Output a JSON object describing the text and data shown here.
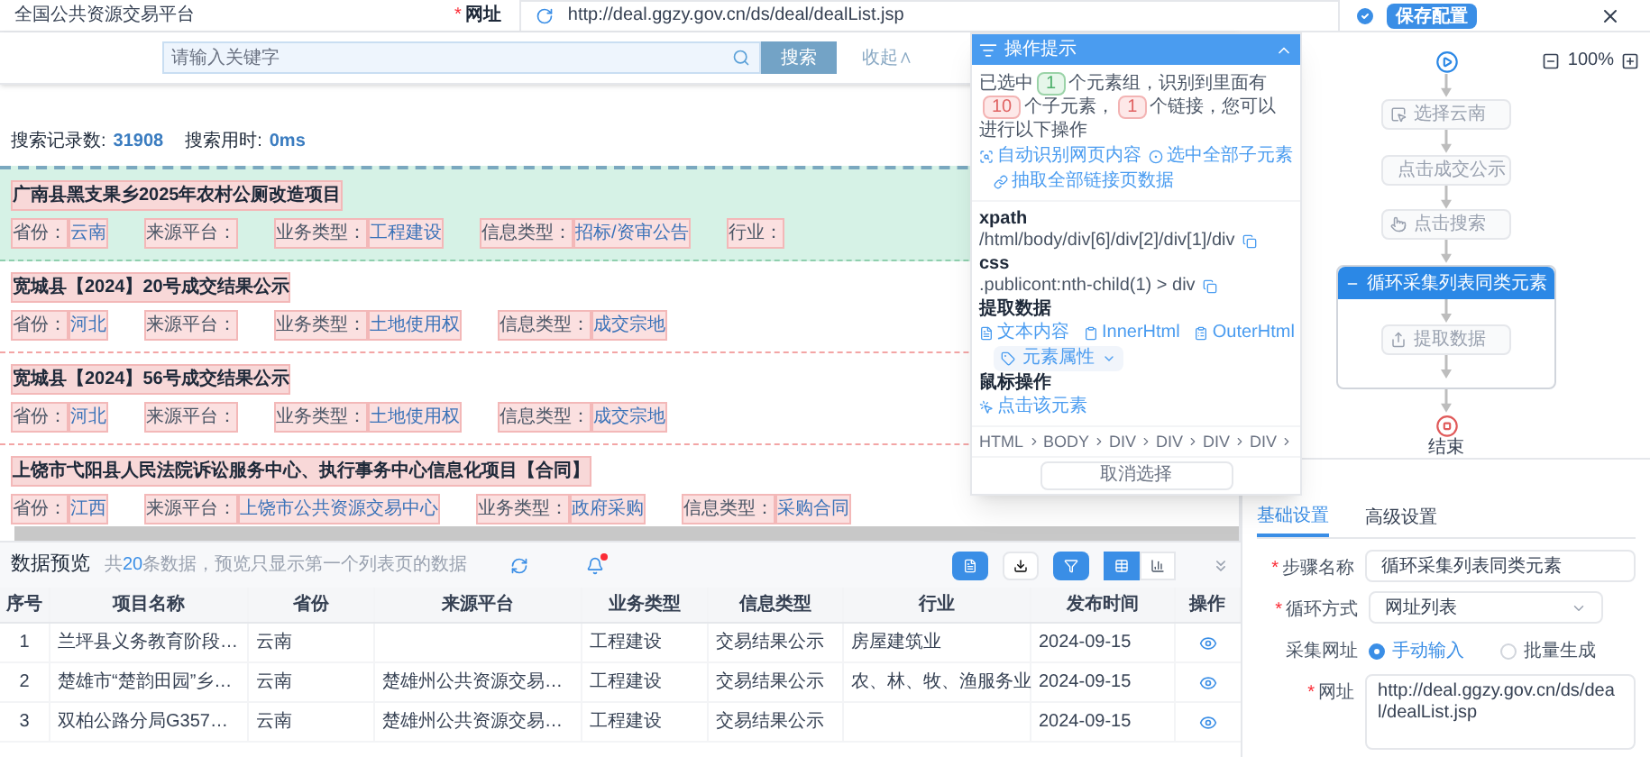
{
  "top_bar": {
    "site_title": "全国公共资源交易平台",
    "required_mark": "*",
    "url_label": "网址",
    "url": "http://deal.ggzy.gov.cn/ds/deal/dealList.jsp",
    "save_button": "保存配置"
  },
  "preview": {
    "search": {
      "placeholder": "请输入关键字",
      "button": "搜索",
      "collapse": "收起∧"
    },
    "stats": [
      {
        "label": "搜索记录数:",
        "value": "31908"
      },
      {
        "label": "搜索用时:",
        "value": "0ms"
      }
    ],
    "items": [
      {
        "title": "广南县黑支果乡2025年农村公厕改造项目",
        "selected": true,
        "fields": [
          {
            "label": "省份：",
            "value": "云南"
          },
          {
            "label": "来源平台："
          },
          {
            "label": "业务类型：",
            "value": "工程建设"
          },
          {
            "label": "信息类型：",
            "value": "招标/资审公告"
          },
          {
            "label": "行业："
          }
        ]
      },
      {
        "title": "宽城县【2024】20号成交结果公示",
        "selected": false,
        "fields": [
          {
            "label": "省份：",
            "value": "河北"
          },
          {
            "label": "来源平台："
          },
          {
            "label": "业务类型：",
            "value": "土地使用权"
          },
          {
            "label": "信息类型：",
            "value": "成交宗地"
          }
        ]
      },
      {
        "title": "宽城县【2024】56号成交结果公示",
        "selected": false,
        "fields": [
          {
            "label": "省份：",
            "value": "河北"
          },
          {
            "label": "来源平台："
          },
          {
            "label": "业务类型：",
            "value": "土地使用权"
          },
          {
            "label": "信息类型：",
            "value": "成交宗地"
          }
        ]
      },
      {
        "title": "上饶市弋阳县人民法院诉讼服务中心、执行事务中心信息化项目【合同】",
        "selected": false,
        "fields": [
          {
            "label": "省份：",
            "value": "江西"
          },
          {
            "label": "来源平台：",
            "value": "上饶市公共资源交易中心"
          },
          {
            "label": "业务类型：",
            "value": "政府采购"
          },
          {
            "label": "信息类型：",
            "value": "采购合同"
          }
        ]
      }
    ]
  },
  "hint_popup": {
    "title": "操作提示",
    "message": [
      {
        "kind": "text",
        "text": "已选中"
      },
      {
        "kind": "ok",
        "text": "1"
      },
      {
        "kind": "text",
        "text": "个元素组，识别到里面有"
      },
      {
        "kind": "alert",
        "text": "10"
      },
      {
        "kind": "text",
        "text": "个子元素，"
      },
      {
        "kind": "alert",
        "text": "1"
      },
      {
        "kind": "text",
        "text": "个链接，您可以进行以下操作"
      }
    ],
    "actions": [
      {
        "kind": "auto",
        "label": "自动识别网页内容"
      },
      {
        "kind": "select",
        "label": "选中全部子元素"
      },
      {
        "kind": "link",
        "label": "抽取全部链接页数据"
      }
    ],
    "selectors": [
      {
        "label": "xpath",
        "value": "/html/body/div[6]/div[2]/div[1]/div"
      },
      {
        "label": "css",
        "value": ".publicont:nth-child(1) > div"
      }
    ],
    "extract_title": "提取数据",
    "extract_buttons": [
      {
        "kind": "text",
        "label": "文本内容"
      },
      {
        "kind": "inner",
        "label": "InnerHtml"
      },
      {
        "kind": "outer",
        "label": "OuterHtml"
      }
    ],
    "attribute_dropdown": "元素属性",
    "mouse_title": "鼠标操作",
    "mouse_action": "点击该元素",
    "breadcrumb": [
      "HTML",
      "BODY",
      "DIV",
      "DIV",
      "DIV",
      "DIV"
    ],
    "cancel_button": "取消选择"
  },
  "flow": {
    "zoom": "100%",
    "steps": [
      {
        "kind": "select",
        "label": "选择云南"
      },
      {
        "kind": "click",
        "label": "点击成交公示"
      },
      {
        "kind": "click",
        "label": "点击搜索"
      },
      {
        "kind": "loop",
        "label": "循环采集列表同类元素",
        "selected": true,
        "children": [
          {
            "kind": "extract",
            "label": "提取数据"
          }
        ]
      }
    ],
    "end": "结束"
  },
  "data_preview": {
    "title": "数据预览",
    "summary_before": "共",
    "count": "20",
    "summary_after": "条数据，预览只显示第一个列表页的数据",
    "has_notification": true,
    "view_modes": [
      {
        "kind": "table",
        "selected": true
      },
      {
        "kind": "chart",
        "selected": false
      }
    ],
    "columns": [
      "序号",
      "项目名称",
      "省份",
      "来源平台",
      "业务类型",
      "信息类型",
      "行业",
      "发布时间",
      "操作"
    ],
    "rows": [
      [
        "1",
        "兰坪县义务教育阶段…",
        "云南",
        "",
        "工程建设",
        "交易结果公示",
        "房屋建筑业",
        "2024-09-15"
      ],
      [
        "2",
        "楚雄市“楚韵田园”乡…",
        "云南",
        "楚雄州公共资源交易…",
        "工程建设",
        "交易结果公示",
        "农、林、牧、渔服务业",
        "2024-09-15"
      ],
      [
        "3",
        "双柏公路分局G357…",
        "云南",
        "楚雄州公共资源交易…",
        "工程建设",
        "交易结果公示",
        "",
        "2024-09-15"
      ]
    ]
  },
  "settings": {
    "tabs": [
      {
        "label": "基础设置",
        "selected": true
      },
      {
        "label": "高级设置",
        "selected": false
      }
    ],
    "fields": [
      {
        "kind": "input",
        "required_mark": "*",
        "label": "步骤名称",
        "value": "循环采集列表同类元素"
      },
      {
        "kind": "select",
        "required_mark": "*",
        "label": "循环方式",
        "value": "网址列表"
      },
      {
        "kind": "radio",
        "label": "采集网址",
        "options": [
          {
            "label": "手动输入",
            "selected": true
          },
          {
            "label": "批量生成",
            "selected": false
          }
        ]
      },
      {
        "kind": "textarea",
        "required_mark": "*",
        "label": "网址",
        "value": "http://deal.ggzy.gov.cn/ds/deal/dealList.jsp"
      }
    ]
  }
}
